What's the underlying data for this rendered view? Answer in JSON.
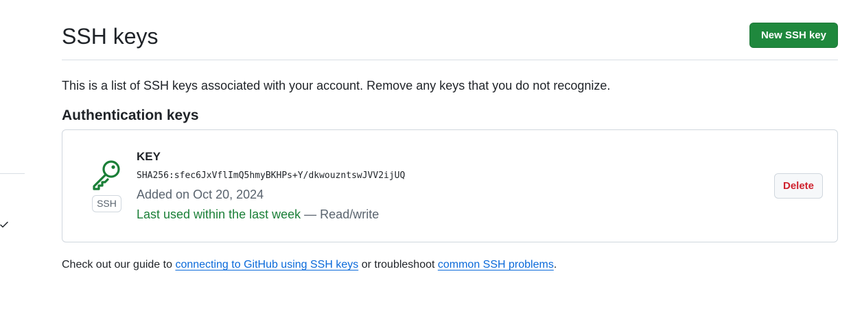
{
  "header": {
    "title": "SSH keys",
    "new_key_button": "New SSH key"
  },
  "intro": "This is a list of SSH keys associated with your account. Remove any keys that you do not recognize.",
  "section_title": "Authentication keys",
  "keys": [
    {
      "type_badge": "SSH",
      "title": "KEY",
      "fingerprint": "SHA256:sfec6JxVflImQ5hmyBKHPs+Y/dkwouzntswJVV2ijUQ",
      "added": "Added on Oct 20, 2024",
      "last_used": "Last used within the last week",
      "separator": "—",
      "access": "Read/write",
      "delete_button": "Delete"
    }
  ],
  "footer": {
    "prefix": "Check out our guide to ",
    "link1": "connecting to GitHub using SSH keys",
    "middle": " or troubleshoot ",
    "link2": "common SSH problems",
    "suffix": "."
  },
  "icons": {
    "key": "key-icon",
    "sidebar_check": "check-icon"
  },
  "colors": {
    "primary_button": "#1f883d",
    "danger_text": "#cf222e",
    "key_icon": "#1a7f37",
    "recent_use": "#1a7f37",
    "link": "#0969da",
    "border": "#d0d7de"
  }
}
